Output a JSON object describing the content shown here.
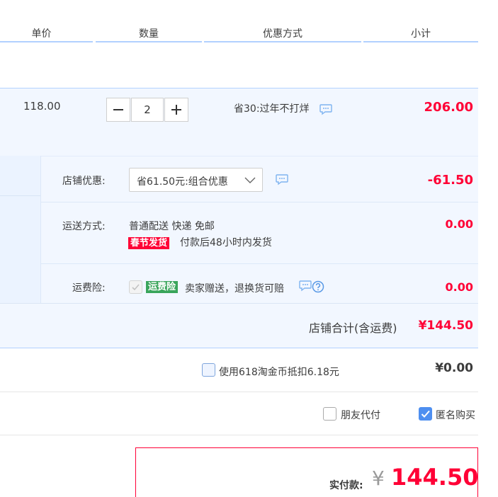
{
  "header": {
    "col_unit_price": "单价",
    "col_quantity": "数量",
    "col_discount": "优惠方式",
    "col_subtotal": "小计"
  },
  "item": {
    "unit_price": "118.00",
    "quantity": "2",
    "discount_text": "省30:过年不打烊",
    "subtotal": "206.00"
  },
  "shop_discount": {
    "label": "店铺优惠:",
    "selected": "省61.50元:组合优惠",
    "amount": "-61.50"
  },
  "shipping": {
    "label": "运送方式:",
    "method": "普通配送 快递 免邮",
    "badge": "春节发货",
    "note": "付款后48小时内发货",
    "amount": "0.00"
  },
  "insurance": {
    "label": "运费险:",
    "badge": "运费险",
    "text": "卖家赠送，退换货可赔",
    "amount": "0.00"
  },
  "shop_total": {
    "label": "店铺合计(含运费)",
    "amount": "¥144.50"
  },
  "coins": {
    "label": "使用618淘金币抵扣6.18元",
    "amount": "¥0.00"
  },
  "options": {
    "friend_pay": "朋友代付",
    "anonymous": "匿名购买"
  },
  "order": {
    "label": "实付款:",
    "currency": "¥",
    "amount": "144.50"
  },
  "colors": {
    "accent_red": "#ff0036",
    "header_blue_line": "#b2d1ff",
    "row_bg": "#f2f7ff",
    "checkbox_blue": "#4e8ff0",
    "badge_green": "#3aa55b"
  }
}
